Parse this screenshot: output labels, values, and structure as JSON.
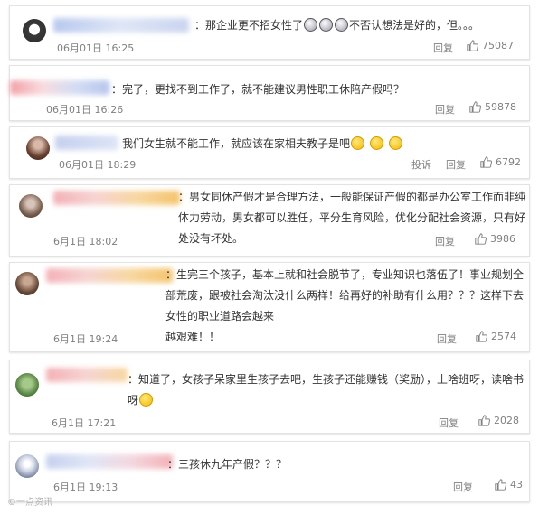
{
  "comments": [
    {
      "text": "那企业更不招女性了",
      "text_tail": "不否认想法是好的，但。。。",
      "time": "06月01日 16:25",
      "reply": "回复",
      "likes": "75087"
    },
    {
      "text": "完了，更找不到工作了，就不能建议男性职工休陪产假吗？",
      "time": "06月01日 16:26",
      "reply": "回复",
      "likes": "59878"
    },
    {
      "text": "我们女生就不能工作，就应该在家相夫教子是吧",
      "time": "06月01日 18:29",
      "report": "投诉",
      "reply": "回复",
      "likes": "6792"
    },
    {
      "text": "男女同休产假才是合理方法，一般能保证产假的都是办公室工作而非纯\n体力劳动，男女都可以胜任，平分生育风险，优化分配社会资源，只有好处没有坏处。",
      "time": "6月1日 18:02",
      "reply": "回复",
      "likes": "3986"
    },
    {
      "text": "生完三个孩子，基本上就和社会脱节了，专业知识也落伍了！事业规划全\n部荒废，跟被社会淘汰没什么两样！给再好的补助有什么用？？？这样下去女性的职业道路会越来\n越艰难！！",
      "time": "6月1日 19:24",
      "reply": "回复",
      "likes": "2574"
    },
    {
      "text": "知道了，女孩子呆家里生孩子去吧，生孩子还能赚钱（奖励），上啥班呀，读啥书\n呀",
      "time": "6月1日 17:21",
      "reply": "回复",
      "likes": "2028"
    },
    {
      "text": "三孩休九年产假？？？",
      "time": "6月1日 19:13",
      "reply": "回复",
      "likes": "43"
    }
  ],
  "watermark": "©一点资讯"
}
